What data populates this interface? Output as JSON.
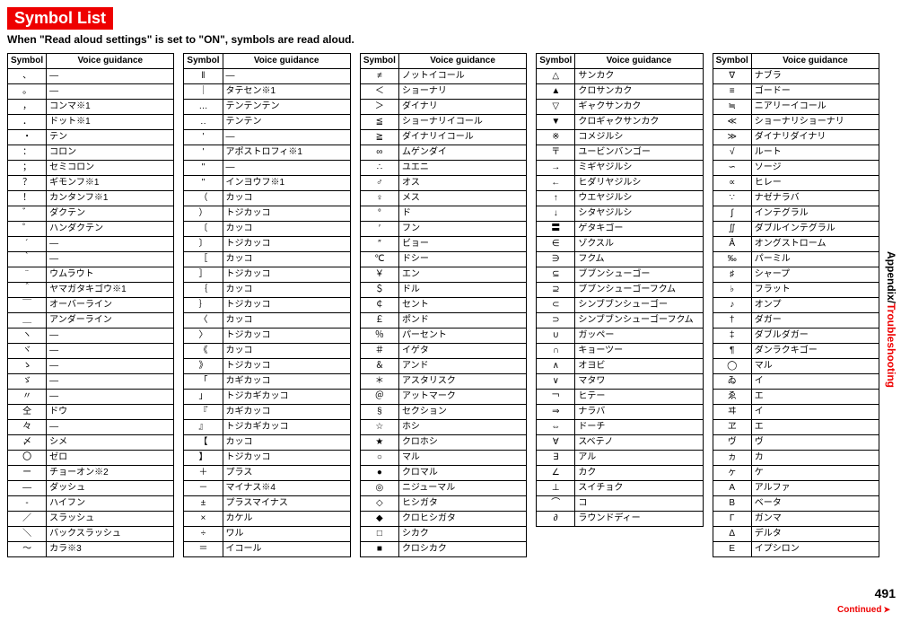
{
  "title": "Symbol List",
  "subtitle": "When \"Read aloud settings\" is set to \"ON\", symbols are read aloud.",
  "side_label_black": "Appendix/",
  "side_label_red": "Troubleshooting",
  "continued": "Continued",
  "page_num": "491",
  "headers": {
    "symbol": "Symbol",
    "voice": "Voice guidance"
  },
  "tables": [
    [
      [
        "、",
        "―"
      ],
      [
        "。",
        "―"
      ],
      [
        "，",
        "コンマ※1"
      ],
      [
        "．",
        "ドット※1"
      ],
      [
        "・",
        "テン"
      ],
      [
        "：",
        "コロン"
      ],
      [
        "；",
        "セミコロン"
      ],
      [
        "？",
        "ギモンフ※1"
      ],
      [
        "！",
        "カンタンフ※1"
      ],
      [
        "゛",
        "ダクテン"
      ],
      [
        "゜",
        "ハンダクテン"
      ],
      [
        "´",
        "―"
      ],
      [
        "｀",
        "―"
      ],
      [
        "¨",
        "ウムラウト"
      ],
      [
        "＾",
        "ヤマガタキゴウ※1"
      ],
      [
        "￣",
        "オーバーライン"
      ],
      [
        "＿",
        "アンダーライン"
      ],
      [
        "ヽ",
        "―"
      ],
      [
        "ヾ",
        "―"
      ],
      [
        "ゝ",
        "―"
      ],
      [
        "ゞ",
        "―"
      ],
      [
        "〃",
        "―"
      ],
      [
        "仝",
        "ドウ"
      ],
      [
        "々",
        "―"
      ],
      [
        "〆",
        "シメ"
      ],
      [
        "〇",
        "ゼロ"
      ],
      [
        "ー",
        "チョーオン※2"
      ],
      [
        "―",
        "ダッシュ"
      ],
      [
        "‐",
        "ハイフン"
      ],
      [
        "／",
        "スラッシュ"
      ],
      [
        "＼",
        "バックスラッシュ"
      ],
      [
        "～",
        "カラ※3"
      ]
    ],
    [
      [
        "‖",
        "―"
      ],
      [
        "｜",
        "タテセン※1"
      ],
      [
        "…",
        "テンテンテン"
      ],
      [
        "‥",
        "テンテン"
      ],
      [
        "'",
        "―"
      ],
      [
        "'",
        "アポストロフィ※1"
      ],
      [
        "\"",
        "―"
      ],
      [
        "\"",
        "インヨウフ※1"
      ],
      [
        "（",
        "カッコ"
      ],
      [
        "）",
        "トジカッコ"
      ],
      [
        "〔",
        "カッコ"
      ],
      [
        "〕",
        "トジカッコ"
      ],
      [
        "［",
        "カッコ"
      ],
      [
        "］",
        "トジカッコ"
      ],
      [
        "｛",
        "カッコ"
      ],
      [
        "｝",
        "トジカッコ"
      ],
      [
        "〈",
        "カッコ"
      ],
      [
        "〉",
        "トジカッコ"
      ],
      [
        "《",
        "カッコ"
      ],
      [
        "》",
        "トジカッコ"
      ],
      [
        "「",
        "カギカッコ"
      ],
      [
        "」",
        "トジカギカッコ"
      ],
      [
        "『",
        "カギカッコ"
      ],
      [
        "』",
        "トジカギカッコ"
      ],
      [
        "【",
        "カッコ"
      ],
      [
        "】",
        "トジカッコ"
      ],
      [
        "＋",
        "プラス"
      ],
      [
        "－",
        "マイナス※4"
      ],
      [
        "±",
        "プラスマイナス"
      ],
      [
        "×",
        "カケル"
      ],
      [
        "÷",
        "ワル"
      ],
      [
        "＝",
        "イコール"
      ]
    ],
    [
      [
        "≠",
        "ノットイコール"
      ],
      [
        "＜",
        "ショーナリ"
      ],
      [
        "＞",
        "ダイナリ"
      ],
      [
        "≦",
        "ショーナリイコール"
      ],
      [
        "≧",
        "ダイナリイコール"
      ],
      [
        "∞",
        "ムゲンダイ"
      ],
      [
        "∴",
        "ユエニ"
      ],
      [
        "♂",
        "オス"
      ],
      [
        "♀",
        "メス"
      ],
      [
        "°",
        "ド"
      ],
      [
        "′",
        "フン"
      ],
      [
        "″",
        "ビョー"
      ],
      [
        "℃",
        "ドシー"
      ],
      [
        "￥",
        "エン"
      ],
      [
        "＄",
        "ドル"
      ],
      [
        "￠",
        "セント"
      ],
      [
        "￡",
        "ポンド"
      ],
      [
        "％",
        "パーセント"
      ],
      [
        "＃",
        "イゲタ"
      ],
      [
        "＆",
        "アンド"
      ],
      [
        "＊",
        "アスタリスク"
      ],
      [
        "＠",
        "アットマーク"
      ],
      [
        "§",
        "セクション"
      ],
      [
        "☆",
        "ホシ"
      ],
      [
        "★",
        "クロホシ"
      ],
      [
        "○",
        "マル"
      ],
      [
        "●",
        "クロマル"
      ],
      [
        "◎",
        "ニジューマル"
      ],
      [
        "◇",
        "ヒシガタ"
      ],
      [
        "◆",
        "クロヒシガタ"
      ],
      [
        "□",
        "シカク"
      ],
      [
        "■",
        "クロシカク"
      ]
    ],
    [
      [
        "△",
        "サンカク"
      ],
      [
        "▲",
        "クロサンカク"
      ],
      [
        "▽",
        "ギャクサンカク"
      ],
      [
        "▼",
        "クロギャクサンカク"
      ],
      [
        "※",
        "コメジルシ"
      ],
      [
        "〒",
        "ユービンバンゴー"
      ],
      [
        "→",
        "ミギヤジルシ"
      ],
      [
        "←",
        "ヒダリヤジルシ"
      ],
      [
        "↑",
        "ウエヤジルシ"
      ],
      [
        "↓",
        "シタヤジルシ"
      ],
      [
        "〓",
        "ゲタキゴー"
      ],
      [
        "∈",
        "ゾクスル"
      ],
      [
        "∋",
        "フクム"
      ],
      [
        "⊆",
        "ブブンシューゴー"
      ],
      [
        "⊇",
        "ブブンシューゴーフクム"
      ],
      [
        "⊂",
        "シンブブンシューゴー"
      ],
      [
        "⊃",
        "シンブブンシューゴーフクム"
      ],
      [
        "∪",
        "ガッペー"
      ],
      [
        "∩",
        "キョーツー"
      ],
      [
        "∧",
        "オヨビ"
      ],
      [
        "∨",
        "マタワ"
      ],
      [
        "￢",
        "ヒテー"
      ],
      [
        "⇒",
        "ナラバ"
      ],
      [
        "⇔",
        "ドーチ"
      ],
      [
        "∀",
        "スベテノ"
      ],
      [
        "∃",
        "アル"
      ],
      [
        "∠",
        "カク"
      ],
      [
        "⊥",
        "スイチョク"
      ],
      [
        "⌒",
        "コ"
      ],
      [
        "∂",
        "ラウンドディー"
      ]
    ],
    [
      [
        "∇",
        "ナブラ"
      ],
      [
        "≡",
        "ゴードー"
      ],
      [
        "≒",
        "ニアリーイコール"
      ],
      [
        "≪",
        "ショーナリショーナリ"
      ],
      [
        "≫",
        "ダイナリダイナリ"
      ],
      [
        "√",
        "ルート"
      ],
      [
        "∽",
        "ソージ"
      ],
      [
        "∝",
        "ヒレー"
      ],
      [
        "∵",
        "ナゼナラバ"
      ],
      [
        "∫",
        "インテグラル"
      ],
      [
        "∬",
        "ダブルインテグラル"
      ],
      [
        "Å",
        "オングストローム"
      ],
      [
        "‰",
        "パーミル"
      ],
      [
        "♯",
        "シャープ"
      ],
      [
        "♭",
        "フラット"
      ],
      [
        "♪",
        "オンプ"
      ],
      [
        "†",
        "ダガー"
      ],
      [
        "‡",
        "ダブルダガー"
      ],
      [
        "¶",
        "ダンラクキゴー"
      ],
      [
        "◯",
        "マル"
      ],
      [
        "ゐ",
        "イ"
      ],
      [
        "ゑ",
        "エ"
      ],
      [
        "ヰ",
        "イ"
      ],
      [
        "ヱ",
        "エ"
      ],
      [
        "ヴ",
        "ヴ"
      ],
      [
        "ヵ",
        "カ"
      ],
      [
        "ヶ",
        "ケ"
      ],
      [
        "Α",
        "アルファ"
      ],
      [
        "Β",
        "ベータ"
      ],
      [
        "Γ",
        "ガンマ"
      ],
      [
        "Δ",
        "デルタ"
      ],
      [
        "Ε",
        "イプシロン"
      ]
    ]
  ]
}
